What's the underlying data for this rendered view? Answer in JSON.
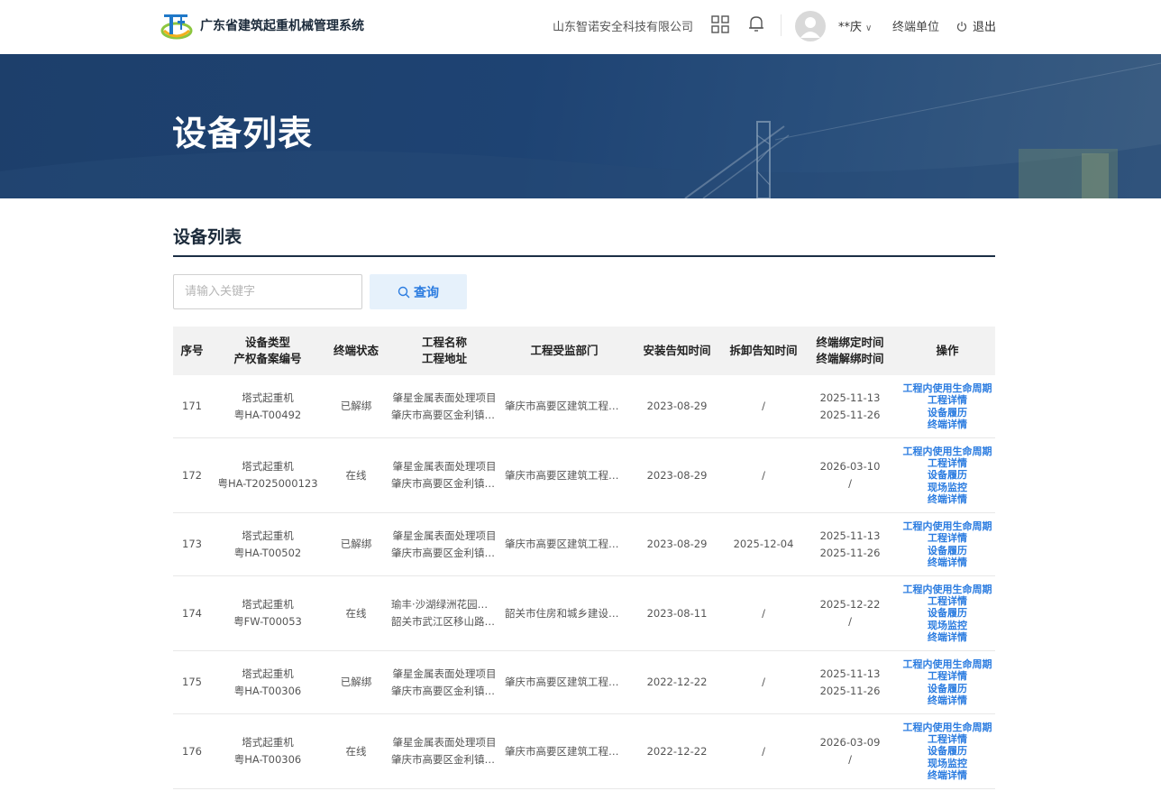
{
  "header": {
    "app_title": "广东省建筑起重机械管理系统",
    "company": "山东智诺安全科技有限公司",
    "user_name": "**庆",
    "terminal_unit": "终端单位",
    "logout": "退出",
    "icons": [
      "crane-logo-icon",
      "app-grid-icon",
      "bell-icon",
      "user-avatar-icon",
      "chevron-down-icon",
      "power-icon"
    ]
  },
  "banner": {
    "title": "设备列表"
  },
  "section": {
    "title": "设备列表"
  },
  "search": {
    "placeholder": "请输入关键字",
    "value": "",
    "button_label": "查询"
  },
  "colors": {
    "accent": "#2b7ce0",
    "banner": "#1e4373",
    "search_button_bg": "#e6f1fb"
  },
  "table": {
    "headers": {
      "index": "序号",
      "type": "设备类型",
      "record_no": "产权备案编号",
      "status": "终端状态",
      "project_name": "工程名称",
      "project_address": "工程地址",
      "supervision": "工程受监部门",
      "install_notice": "安装告知时间",
      "dismantle_notice": "拆卸告知时间",
      "bind_time": "终端绑定时间",
      "unbind_time": "终端解绑时间",
      "actions": "操作"
    },
    "rows": [
      {
        "index": "171",
        "type": "塔式起重机",
        "record_no": "粤HA-T00492",
        "status": "已解绑",
        "project_name": "肇星金属表面处理项目",
        "project_address": "肇庆市高要区金利镇工业园",
        "supervision": "肇庆市高要区建筑工程安全监督站",
        "install_notice": "2023-08-29",
        "dismantle_notice": "/",
        "bind_time": "2025-11-13",
        "unbind_time": "2025-11-26",
        "actions": [
          "工程内使用生命周期",
          "工程详情",
          "设备履历",
          "终端详情"
        ]
      },
      {
        "index": "172",
        "type": "塔式起重机",
        "record_no": "粤HA-T2025000123",
        "status": "在线",
        "project_name": "肇星金属表面处理项目",
        "project_address": "肇庆市高要区金利镇工业园",
        "supervision": "肇庆市高要区建筑工程安全监督站",
        "install_notice": "2023-08-29",
        "dismantle_notice": "/",
        "bind_time": "2026-03-10",
        "unbind_time": "/",
        "actions": [
          "工程内使用生命周期",
          "工程详情",
          "设备履历",
          "现场监控",
          "终端详情"
        ]
      },
      {
        "index": "173",
        "type": "塔式起重机",
        "record_no": "粤HA-T00502",
        "status": "已解绑",
        "project_name": "肇星金属表面处理项目",
        "project_address": "肇庆市高要区金利镇工业园",
        "supervision": "肇庆市高要区建筑工程安全监督站",
        "install_notice": "2023-08-29",
        "dismantle_notice": "2025-12-04",
        "bind_time": "2025-11-13",
        "unbind_time": "2025-11-26",
        "actions": [
          "工程内使用生命周期",
          "工程详情",
          "设备履历",
          "终端详情"
        ]
      },
      {
        "index": "174",
        "type": "塔式起重机",
        "record_no": "粤FW-T00053",
        "status": "在线",
        "project_name": "瑜丰·沙湖绿洲花园项目",
        "project_address": "韶关市武江区移山路附近",
        "supervision": "韶关市住房和城乡建设管理局",
        "install_notice": "2023-08-11",
        "dismantle_notice": "/",
        "bind_time": "2025-12-22",
        "unbind_time": "/",
        "actions": [
          "工程内使用生命周期",
          "工程详情",
          "设备履历",
          "现场监控",
          "终端详情"
        ]
      },
      {
        "index": "175",
        "type": "塔式起重机",
        "record_no": "粤HA-T00306",
        "status": "已解绑",
        "project_name": "肇星金属表面处理项目",
        "project_address": "肇庆市高要区金利镇工业园",
        "supervision": "肇庆市高要区建筑工程安全监督站",
        "install_notice": "2022-12-22",
        "dismantle_notice": "/",
        "bind_time": "2025-11-13",
        "unbind_time": "2025-11-26",
        "actions": [
          "工程内使用生命周期",
          "工程详情",
          "设备履历",
          "终端详情"
        ]
      },
      {
        "index": "176",
        "type": "塔式起重机",
        "record_no": "粤HA-T00306",
        "status": "在线",
        "project_name": "肇星金属表面处理项目",
        "project_address": "肇庆市高要区金利镇工业园",
        "supervision": "肇庆市高要区建筑工程安全监督站",
        "install_notice": "2022-12-22",
        "dismantle_notice": "/",
        "bind_time": "2026-03-09",
        "unbind_time": "/",
        "actions": [
          "工程内使用生命周期",
          "工程详情",
          "设备履历",
          "现场监控",
          "终端详情"
        ]
      }
    ]
  }
}
